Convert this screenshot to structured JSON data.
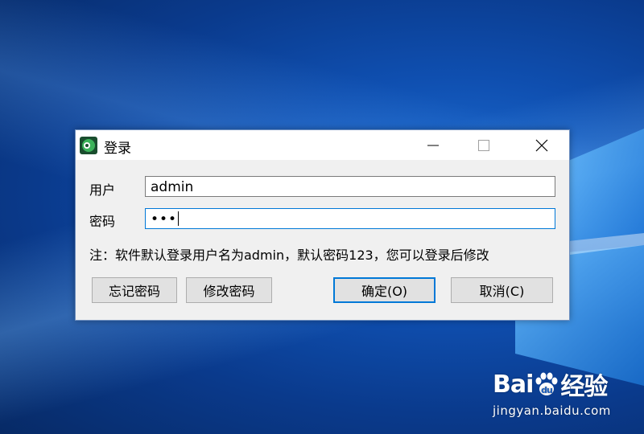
{
  "dialog": {
    "title": "登录",
    "window_buttons": [
      "minimize",
      "maximize",
      "close"
    ],
    "user_label": "用户",
    "user_value": "admin",
    "pwd_label": "密码",
    "pwd_value": "•••",
    "note": "注：软件默认登录用户名为admin，默认密码123，您可以登录后修改",
    "buttons": {
      "forget": "忘记密码",
      "change": "修改密码",
      "ok": "确定(O)",
      "cancel": "取消(C)"
    }
  },
  "watermark": {
    "brand_left": "Bai",
    "brand_right": "经验",
    "site": "jingyan.baidu.com"
  },
  "colors": {
    "accent": "#0078d7",
    "dialog_bg": "#f0f0f0",
    "desktop": "#0f4fb0"
  },
  "icons": [
    "app-icon",
    "minimize-icon",
    "maximize-icon",
    "close-icon",
    "windows-logo-icon",
    "paw-icon"
  ]
}
